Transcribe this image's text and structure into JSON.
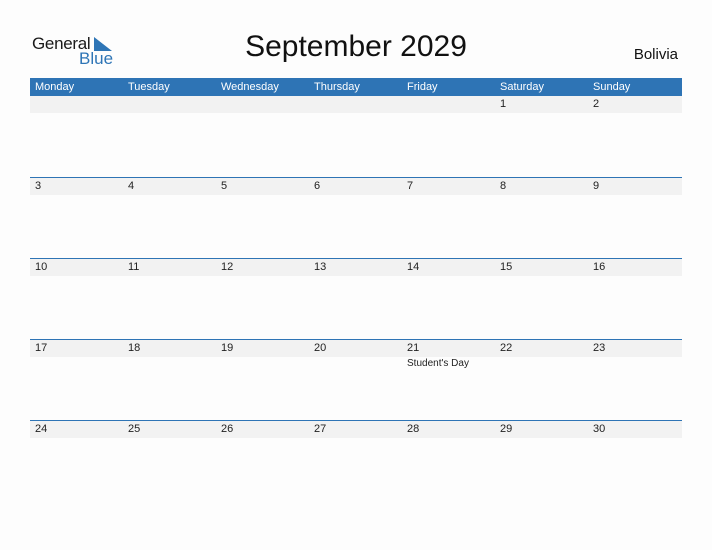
{
  "logo": {
    "line1": "General",
    "line2": "Blue"
  },
  "title": "September 2029",
  "country": "Bolivia",
  "colors": {
    "accent": "#2e74b5",
    "strip": "#f2f2f2"
  },
  "weekdays": [
    "Monday",
    "Tuesday",
    "Wednesday",
    "Thursday",
    "Friday",
    "Saturday",
    "Sunday"
  ],
  "weeks": [
    {
      "days": [
        "",
        "",
        "",
        "",
        "",
        "1",
        "2"
      ],
      "events": [
        "",
        "",
        "",
        "",
        "",
        "",
        ""
      ]
    },
    {
      "days": [
        "3",
        "4",
        "5",
        "6",
        "7",
        "8",
        "9"
      ],
      "events": [
        "",
        "",
        "",
        "",
        "",
        "",
        ""
      ]
    },
    {
      "days": [
        "10",
        "11",
        "12",
        "13",
        "14",
        "15",
        "16"
      ],
      "events": [
        "",
        "",
        "",
        "",
        "",
        "",
        ""
      ]
    },
    {
      "days": [
        "17",
        "18",
        "19",
        "20",
        "21",
        "22",
        "23"
      ],
      "events": [
        "",
        "",
        "",
        "",
        "Student's Day",
        "",
        ""
      ]
    },
    {
      "days": [
        "24",
        "25",
        "26",
        "27",
        "28",
        "29",
        "30"
      ],
      "events": [
        "",
        "",
        "",
        "",
        "",
        "",
        ""
      ]
    }
  ]
}
